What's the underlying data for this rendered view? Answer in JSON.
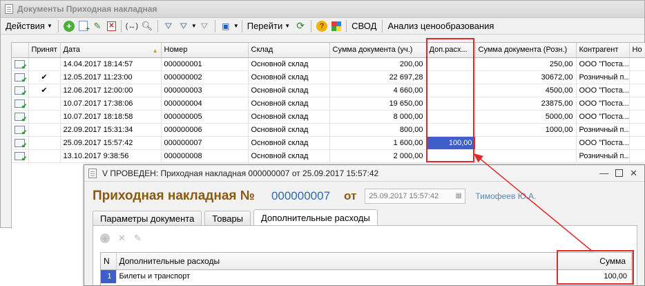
{
  "list_window": {
    "title": "Документы Приходная накладная",
    "toolbar": {
      "actions_label": "Действия",
      "goto_label": "Перейти",
      "svod_label": "СВОД",
      "analysis_label": "Анализ ценообразования"
    },
    "columns": [
      "Принят",
      "Дата",
      "Номер",
      "Склад",
      "Сумма документа (уч.)",
      "Доп.расх...",
      "Сумма документа (Розн.)",
      "Контрагент",
      "Но"
    ],
    "rows": [
      {
        "accepted": "",
        "date": "14.04.2017 18:14:57",
        "number": "000000001",
        "warehouse": "Основной склад",
        "sum": "200,00",
        "extra": "",
        "retail": "250,00",
        "counterparty": "ООО \"Поста..."
      },
      {
        "accepted": "✔",
        "date": "12.05.2017 11:23:00",
        "number": "000000002",
        "warehouse": "Основной склад",
        "sum": "22 697,28",
        "extra": "",
        "retail": "30672,00",
        "counterparty": "Розничный п..."
      },
      {
        "accepted": "✔",
        "date": "12.06.2017 12:00:00",
        "number": "000000003",
        "warehouse": "Основной склад",
        "sum": "4 660,00",
        "extra": "",
        "retail": "4500,00",
        "counterparty": "ООО \"Поста..."
      },
      {
        "accepted": "",
        "date": "10.07.2017 17:38:06",
        "number": "000000004",
        "warehouse": "Основной склад",
        "sum": "19 650,00",
        "extra": "",
        "retail": "23875,00",
        "counterparty": "ООО \"Поста..."
      },
      {
        "accepted": "",
        "date": "10.07.2017 18:18:58",
        "number": "000000005",
        "warehouse": "Основной склад",
        "sum": "8 000,00",
        "extra": "",
        "retail": "5000,00",
        "counterparty": "ООО \"Поста..."
      },
      {
        "accepted": "",
        "date": "22.09.2017 15:31:34",
        "number": "000000006",
        "warehouse": "Основной склад",
        "sum": "800,00",
        "extra": "",
        "retail": "1000,00",
        "counterparty": "Розничный п..."
      },
      {
        "accepted": "",
        "date": "25.09.2017 15:57:42",
        "number": "000000007",
        "warehouse": "Основной склад",
        "sum": "1 600,00",
        "extra": "100,00",
        "retail": "",
        "counterparty": "ООО \"Поста..."
      },
      {
        "accepted": "",
        "date": "13.10.2017 9:38:56",
        "number": "000000008",
        "warehouse": "Основной склад",
        "sum": "2 000,00",
        "extra": "",
        "retail": "",
        "counterparty": "Розничный п..."
      }
    ]
  },
  "doc_window": {
    "title": "V ПРОВЕДЕН: Приходная накладная 000000007 от 25.09.2017 15:57:42",
    "heading": "Приходная накладная №",
    "number": "000000007",
    "from_label": "от",
    "date_value": "25.09.2017 15:57:42",
    "author": "Тимофеев Ю.А.",
    "tabs": [
      "Параметры документа",
      "Товары",
      "Дополнительные расходы"
    ],
    "active_tab_index": 2,
    "sub_table": {
      "headers": [
        "N",
        "Дополнительные расходы",
        "Сумма"
      ],
      "rows": [
        {
          "n": "1",
          "name": "Билеты и транспорт",
          "sum": "100,00"
        }
      ]
    }
  },
  "colors": {
    "highlight_blue": "#3e5fc9",
    "annotation_red": "#e02a2a",
    "doc_title_brown": "#8b5a10",
    "doc_number_blue": "#2b6bb0"
  }
}
